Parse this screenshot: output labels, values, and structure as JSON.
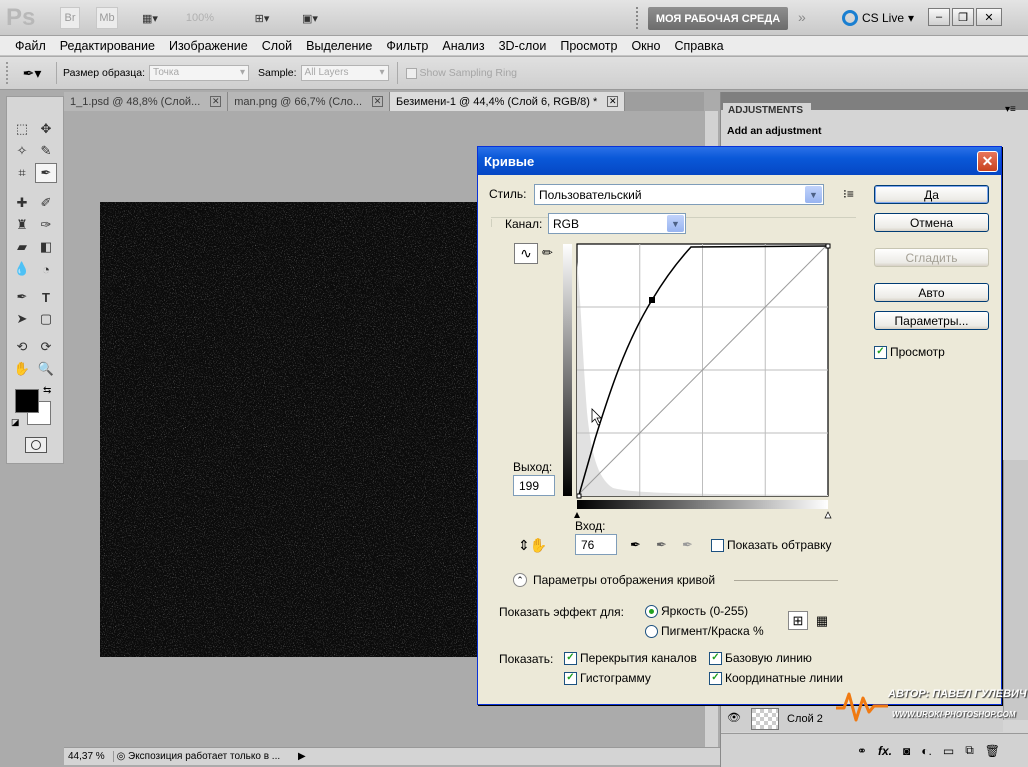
{
  "app": {
    "logo": "Ps",
    "top_icons": [
      "Br",
      "Mb"
    ],
    "zoom": "100%",
    "workspace": "МОЯ РАБОЧАЯ СРЕДА",
    "cslive": "CS Live"
  },
  "menu": [
    "Файл",
    "Редактирование",
    "Изображение",
    "Слой",
    "Выделение",
    "Фильтр",
    "Анализ",
    "3D-слои",
    "Просмотр",
    "Окно",
    "Справка"
  ],
  "options": {
    "sample_size_label": "Размер образца:",
    "sample_size_value": "Точка",
    "sample_label": "Sample:",
    "sample_value": "All Layers",
    "sampling_ring": "Show Sampling Ring"
  },
  "tabs": [
    {
      "label": "1_1.psd @ 48,8% (Слой..."
    },
    {
      "label": "man.png @ 66,7% (Сло..."
    },
    {
      "label": "Безимени-1 @ 44,4% (Слой 6, RGB/8) *"
    }
  ],
  "status": {
    "zoom": "44,37 %",
    "text": "Экспозиция работает только в ..."
  },
  "adjustments": {
    "tab": "ADJUSTMENTS",
    "subtitle": "Add an adjustment"
  },
  "layers": {
    "row_label": "Слой 2"
  },
  "dialog": {
    "title": "Кривые",
    "style_label": "Стиль:",
    "style_value": "Пользовательский",
    "channel_label": "Канал:",
    "channel_value": "RGB",
    "ok": "Да",
    "cancel": "Отмена",
    "smooth": "Сгладить",
    "auto": "Авто",
    "options": "Параметры...",
    "preview": "Просмотр",
    "output_label": "Выход:",
    "output_value": "199",
    "input_label": "Вход:",
    "input_value": "76",
    "show_clipping": "Показать обтравку",
    "curve_options": "Параметры отображения кривой",
    "show_amount_label": "Показать эффект для:",
    "light": "Яркость (0-255)",
    "pigment": "Пигмент/Краска %",
    "show_label": "Показать:",
    "channel_overlays": "Перекрытия каналов",
    "baseline": "Базовую линию",
    "histogram": "Гистограмму",
    "intersection": "Координатные линии"
  },
  "watermark": {
    "line1": "АВТОР: ПАВЕЛ ГУЛЕВИЧ",
    "line2": "WWW.UROKI-PHOTOSHOP.COM"
  }
}
